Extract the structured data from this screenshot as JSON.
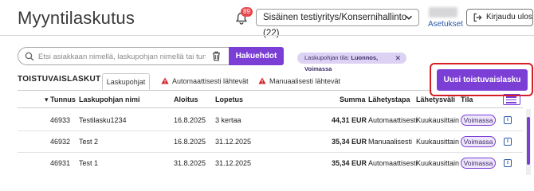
{
  "header": {
    "title": "Myyntilaskutus",
    "notification_count": "89",
    "company_select": "Sisäinen testiyritys/Konsernihallinto (22)",
    "settings_link": "Asetukset",
    "logout_label": "Kirjaudu ulos"
  },
  "search": {
    "placeholder": "Etsi asiakkaan nimellä, laskupohjan nimellä tai tunnuksella",
    "value": "",
    "button_label": "Hakuehdot"
  },
  "filter_chip": {
    "prefix": "Laskupohjan tila: ",
    "value": "Luonnos, Voimassa"
  },
  "section_title": "TOISTUVAISLASKUT",
  "tabs": [
    {
      "label": "Laskupohjat",
      "active": true,
      "warning": false
    },
    {
      "label": "Automaattisesti lähtevät",
      "active": false,
      "warning": true
    },
    {
      "label": "Manuaalisesti lähtevät",
      "active": false,
      "warning": true
    }
  ],
  "new_button_label": "Uusi toistuvaislasku",
  "table": {
    "columns": [
      "Tunnus",
      "Laskupohjan nimi",
      "Aloitus",
      "Lopetus",
      "Summa",
      "Lähetystapa",
      "Lähetysväli",
      "Tila"
    ],
    "sort_indicator": "▾",
    "rows": [
      {
        "id": "46933",
        "name": "Testilasku1234",
        "start": "16.8.2025",
        "end": "3 kertaa",
        "sum": "44,31 EUR",
        "method": "Automaattisesti",
        "interval": "Kuukausittain",
        "status": "Voimassa"
      },
      {
        "id": "46932",
        "name": "Test 2",
        "start": "16.8.2025",
        "end": "31.12.2025",
        "sum": "35,34 EUR",
        "method": "Manuaalisesti",
        "interval": "Kuukausittain",
        "status": "Voimassa"
      },
      {
        "id": "46931",
        "name": "Test 1",
        "start": "31.8.2025",
        "end": "31.12.2025",
        "sum": "35,34 EUR",
        "method": "Automaattisesti",
        "interval": "Kuukausittain",
        "status": "Voimassa"
      }
    ],
    "info_glyph": "i"
  },
  "icons": {
    "bell": "bell-icon",
    "chevron": "chevron-down-icon",
    "logout": "logout-icon",
    "search": "search-icon",
    "trash": "trash-icon",
    "close": "close-icon",
    "warning": "warning-icon",
    "columns": "column-list-icon",
    "info": "info-icon"
  },
  "colors": {
    "accent": "#7b3fd6",
    "badge": "#e5484d",
    "warning": "#d61f26",
    "link": "#2b59a8"
  }
}
